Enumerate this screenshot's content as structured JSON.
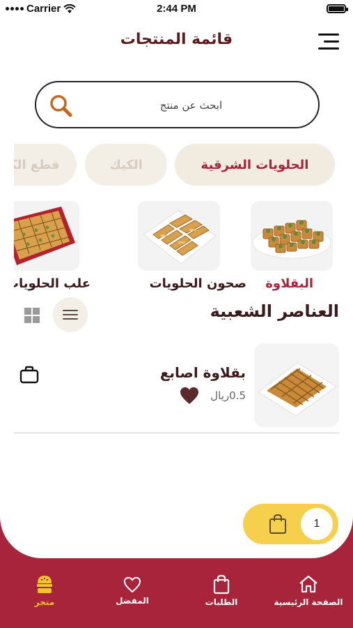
{
  "status": {
    "carrier": "Carrier",
    "time": "2:44 PM"
  },
  "header": {
    "title": "قائمة المنتجات"
  },
  "search": {
    "placeholder": "ابحث عن منتج"
  },
  "categories": [
    {
      "label": "الحلويات الشرقية",
      "active": true
    },
    {
      "label": "الكيك",
      "active": false
    },
    {
      "label": "قطع الكيك",
      "active": false
    }
  ],
  "products": [
    {
      "label": "البقلاوة",
      "selected": true,
      "image": "baklava-squares"
    },
    {
      "label": "صحون الحلويات",
      "selected": false,
      "image": "sweets-platter"
    },
    {
      "label": "علب الحلويات",
      "selected": false,
      "image": "sweets-box"
    }
  ],
  "section": {
    "title": "العناصر الشعبية"
  },
  "items": [
    {
      "name": "بقلاوة اصابع",
      "price": "0.5ريال",
      "image": "baklava-fingers"
    }
  ],
  "cart": {
    "count": "1"
  },
  "tabs": [
    {
      "label": "الصفحة الرئيسية",
      "icon": "home-icon"
    },
    {
      "label": "الطلبات",
      "icon": "orders-bag-icon"
    },
    {
      "label": "المفضل",
      "icon": "heart-icon"
    },
    {
      "label": "متجر",
      "icon": "store-icon",
      "active": true
    }
  ],
  "colors": {
    "brand": "#a8243a",
    "accent": "#f6d04d",
    "title": "#5b1c20",
    "chip": "#f1ebe0"
  }
}
